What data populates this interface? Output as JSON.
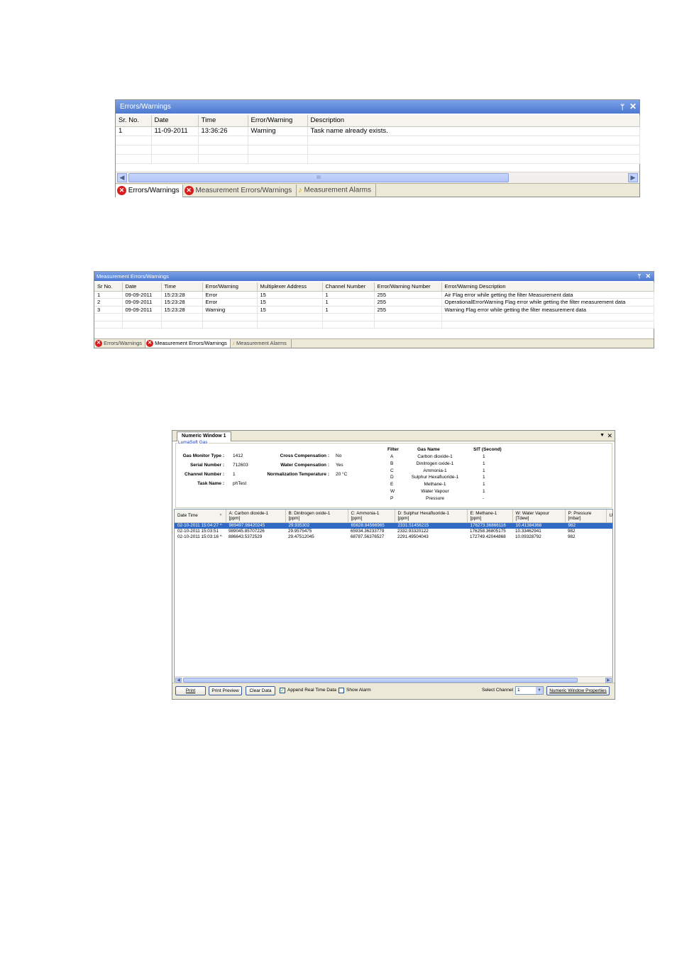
{
  "errors_panel": {
    "title": "Errors/Warnings",
    "columns": [
      "Sr. No.",
      "Date",
      "Time",
      "Error/Warning",
      "Description"
    ],
    "rows": [
      [
        "1",
        "11-09-2011",
        "13:36:26",
        "Warning",
        "Task name already exists."
      ]
    ],
    "scroll_thumb_label": "III",
    "tabs": [
      {
        "label": "Errors/Warnings",
        "icon": "error-icon"
      },
      {
        "label": "Measurement Errors/Warnings",
        "icon": "error-icon"
      },
      {
        "label": "Measurement Alarms",
        "icon": "bell-icon"
      }
    ]
  },
  "meas_panel": {
    "title": "Measurement Errors/Warnings",
    "columns": [
      "Sr No.",
      "Date",
      "Time",
      "Error/Warning",
      "Multiplexer Address",
      "Channel Number",
      "Error/Warning Number",
      "Error/Warning Description"
    ],
    "rows": [
      [
        "1",
        "09-09-2011",
        "15:23:28",
        "Error",
        "15",
        "1",
        "255",
        "Air Flag error while getting the filter Measurement data"
      ],
      [
        "2",
        "09-09-2011",
        "15:23:28",
        "Error",
        "15",
        "1",
        "255",
        "OperationalErrorWarning Flag error while getting the filter measurement data"
      ],
      [
        "3",
        "09-09-2011",
        "15:23:28",
        "Warning",
        "15",
        "1",
        "255",
        "Warning Flag error while getting the filter measurement data"
      ]
    ],
    "tabs": [
      {
        "label": "Errors/Warnings",
        "icon": "error-icon"
      },
      {
        "label": "Measurement Errors/Warnings",
        "icon": "error-icon"
      },
      {
        "label": "Measurement Alarms",
        "icon": "bell-icon"
      }
    ]
  },
  "numeric_window": {
    "tab_title": "Numeric Window 1",
    "group_label": "LumaSoft Gas",
    "info_left": [
      {
        "label": "Gas Monitor Type :",
        "value": "1412"
      },
      {
        "label": "Serial Number :",
        "value": "712603"
      },
      {
        "label": "Channel Number :",
        "value": "1"
      },
      {
        "label": "Task Name :",
        "value": "phTest"
      }
    ],
    "info_mid": [
      {
        "label": "Cross Compensation :",
        "value": "No"
      },
      {
        "label": "Water Compensation :",
        "value": "Yes"
      },
      {
        "label": "Normalization Temperature :",
        "value": "20 °C"
      }
    ],
    "filter_headers": [
      "Filter",
      "Gas Name",
      "SIT (Second)"
    ],
    "filters": [
      [
        "A",
        "Carbon dioxide-1",
        "1"
      ],
      [
        "B",
        "Dinitrogen oxide-1",
        "1"
      ],
      [
        "C",
        "Ammonia-1",
        "1"
      ],
      [
        "D",
        "Sulphur Hexafluoride-1",
        "1"
      ],
      [
        "E",
        "Methane-1",
        "1"
      ],
      [
        "W",
        "Water Vapour",
        "1"
      ],
      [
        "P",
        "Pressure",
        "-"
      ]
    ],
    "columns": [
      [
        "Date Time",
        ""
      ],
      [
        "A: Carbon dioxide-1",
        "[ppm]"
      ],
      [
        "B: Dinitrogen oxide-1",
        "[ppm]"
      ],
      [
        "C: Ammonia-1",
        "[ppm]"
      ],
      [
        "D: Sulphur Hexafluoride-1",
        "[ppm]"
      ],
      [
        "E: Methane-1",
        "[ppm]"
      ],
      [
        "W: Water Vapour",
        "[Tdew]"
      ],
      [
        "P: Pressure",
        "[mbar]"
      ],
      [
        "Us",
        ""
      ]
    ],
    "rows": [
      [
        "02-10-2011 15:04:27 ^",
        "989497.98420245",
        "29.935302",
        "65628.84566965",
        "2331.51456215",
        "176273.36866116",
        "10.41384368",
        "982"
      ],
      [
        "02-10-2011 15:03:51",
        "989045.85707226",
        "29.9575475",
        "65934.36233779",
        "2332.93320122",
        "176258.36805175",
        "10.33462941",
        "982"
      ],
      [
        "02-10-2011 15:03:16 ^",
        "886643.5372529",
        "29.47512045",
        "68787.56376527",
        "2291.49504043",
        "172749.42044868",
        "10.09328792",
        "982"
      ]
    ],
    "buttons": {
      "print": "Print",
      "print_preview": "Print Preview",
      "clear_data": "Clear Data",
      "properties": "Numeric Window Properties"
    },
    "append_label": "Append Real Time Data",
    "append_checked": true,
    "show_alarm_label": "Show Alarm",
    "show_alarm_checked": false,
    "select_channel_label": "Select Channel",
    "select_channel_value": "1"
  }
}
